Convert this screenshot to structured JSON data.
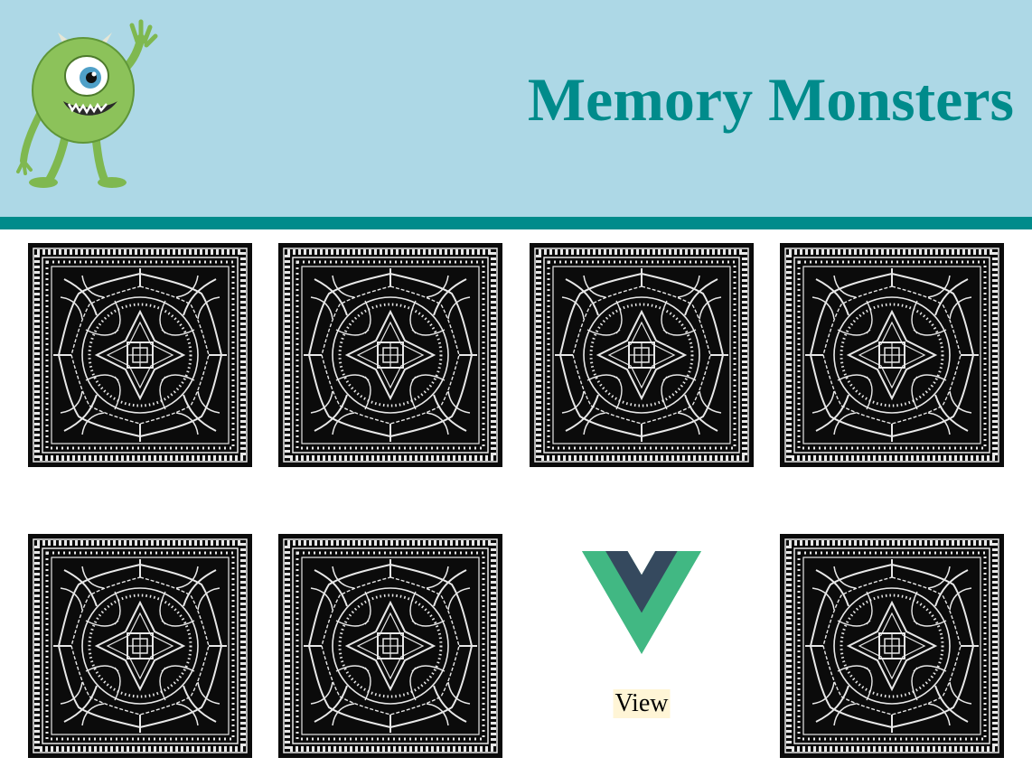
{
  "header": {
    "title": "Memory Monsters",
    "bg_color": "#add8e6",
    "accent_color": "#008b8b",
    "mascot_icon": "one-eyed-green-monster-icon"
  },
  "board": {
    "cards": [
      {
        "state": "face-down",
        "icon": "mandala-pattern-icon"
      },
      {
        "state": "face-down",
        "icon": "mandala-pattern-icon"
      },
      {
        "state": "face-down",
        "icon": "mandala-pattern-icon"
      },
      {
        "state": "face-down",
        "icon": "mandala-pattern-icon"
      },
      {
        "state": "face-down",
        "icon": "mandala-pattern-icon"
      },
      {
        "state": "face-down",
        "icon": "mandala-pattern-icon"
      },
      {
        "state": "face-up",
        "icon": "vue-logo-icon",
        "label": "View"
      },
      {
        "state": "face-down",
        "icon": "mandala-pattern-icon"
      }
    ]
  }
}
